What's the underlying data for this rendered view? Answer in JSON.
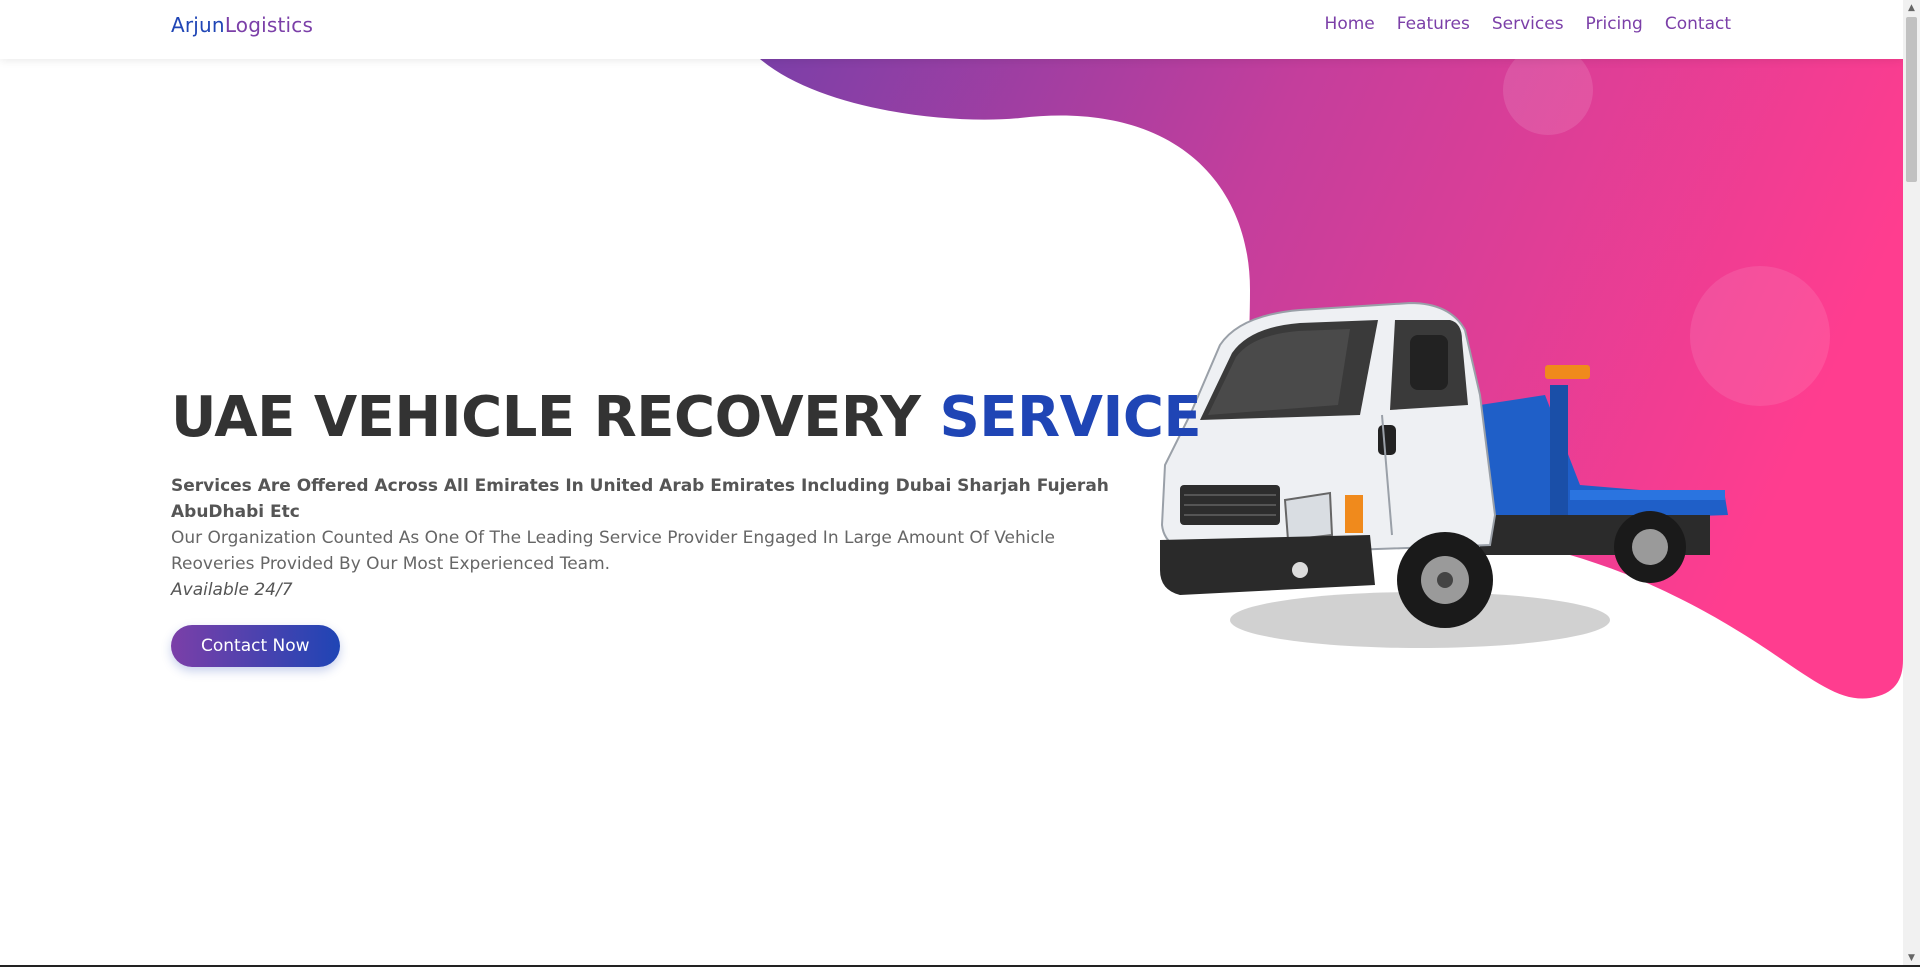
{
  "brand": {
    "part1": "Arjun",
    "part2": "Logistics"
  },
  "nav": {
    "items": [
      {
        "label": "Home"
      },
      {
        "label": "Features"
      },
      {
        "label": "Services"
      },
      {
        "label": "Pricing"
      },
      {
        "label": "Contact"
      }
    ]
  },
  "hero": {
    "title_main": "UAE VEHICLE RECOVERY ",
    "title_accent": "SERVICE",
    "lead": "Services Are Offered Across All Emirates In United Arab Emirates Including Dubai Sharjah Fujerah AbuDhabi Etc",
    "description": "Our Organization Counted As One Of The Leading Service Provider Engaged In Large Amount Of Vehicle Reoveries Provided By Our Most Experienced Team.",
    "availability": "Available 24/7",
    "cta_label": "Contact Now"
  },
  "colors": {
    "brand_blue": "#1f45b5",
    "brand_purple": "#7b3fa8",
    "blob_pink": "#ff3d8f"
  },
  "icons": {
    "hero_image": "tow-truck-illustration",
    "scroll_up": "arrow-up-icon",
    "scroll_down": "arrow-down-icon"
  }
}
